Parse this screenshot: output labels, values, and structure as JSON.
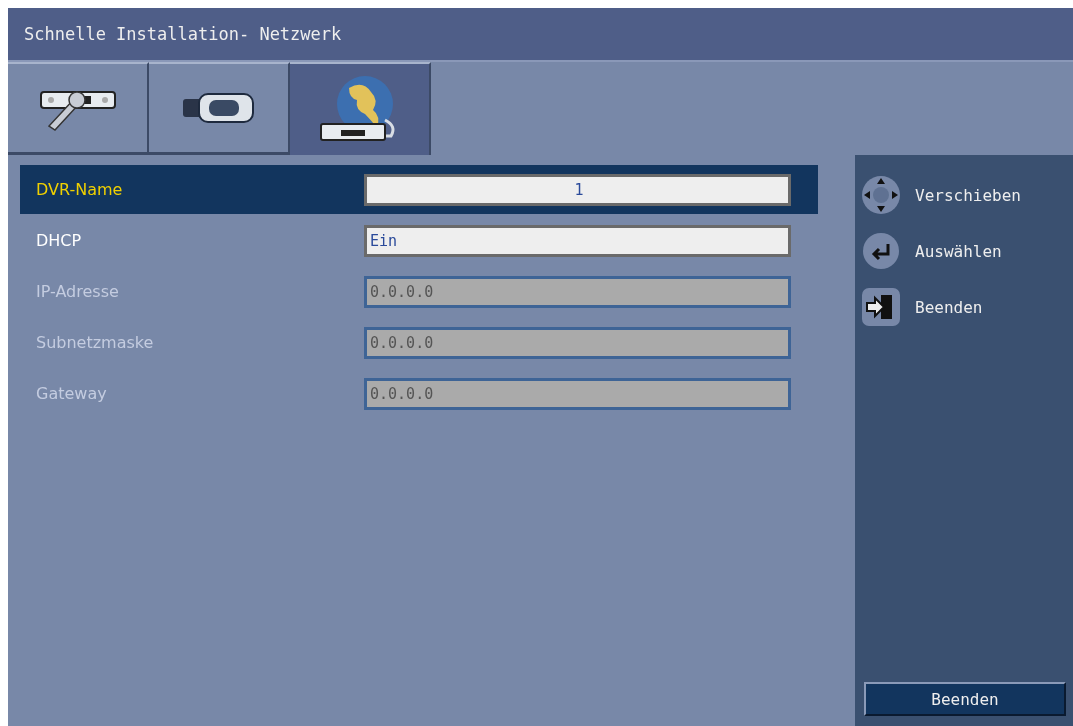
{
  "window": {
    "title": "Schnelle Installation- Netzwerk"
  },
  "tabs": [
    {
      "kind": "tools",
      "selected": false
    },
    {
      "kind": "camera",
      "selected": false
    },
    {
      "kind": "network",
      "selected": true
    }
  ],
  "fields": [
    {
      "label": "DVR-Name",
      "value": "1",
      "kind": "text",
      "selected": true,
      "disabled": false
    },
    {
      "label": "DHCP",
      "value": "Ein",
      "kind": "select",
      "selected": false,
      "disabled": false
    },
    {
      "label": "IP-Adresse",
      "value": "0.0.0.0",
      "kind": "address",
      "selected": false,
      "disabled": true
    },
    {
      "label": "Subnetzmaske",
      "value": "0.0.0.0",
      "kind": "address",
      "selected": false,
      "disabled": true
    },
    {
      "label": "Gateway",
      "value": "0.0.0.0",
      "kind": "address",
      "selected": false,
      "disabled": true
    }
  ],
  "hints": [
    {
      "kind": "move",
      "label": "Verschieben"
    },
    {
      "kind": "select",
      "label": "Auswählen"
    },
    {
      "kind": "exit",
      "label": "Beenden"
    }
  ],
  "exit_button": {
    "label": "Beenden"
  }
}
